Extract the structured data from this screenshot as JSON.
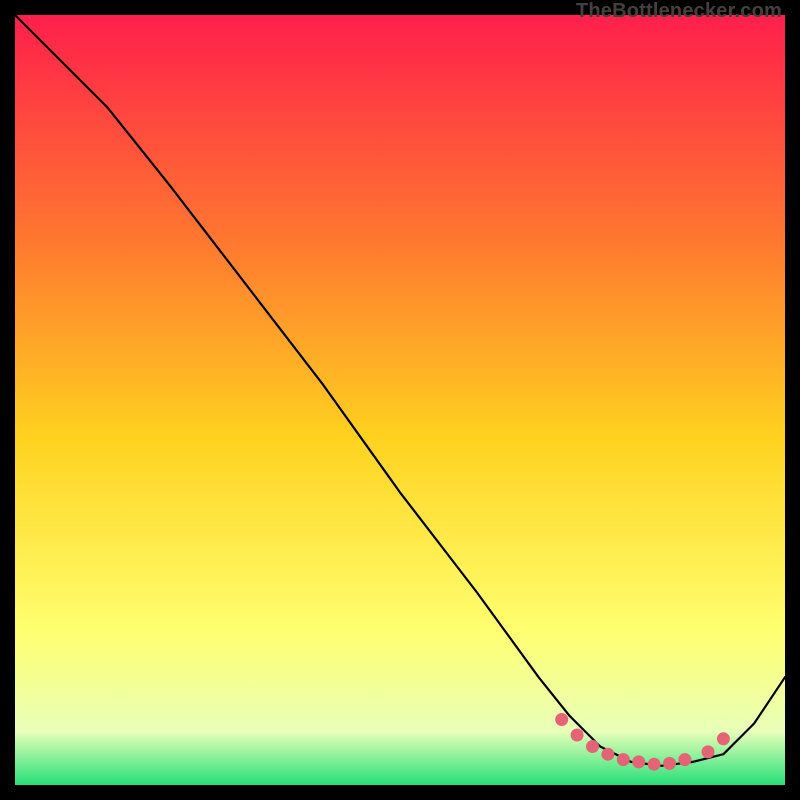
{
  "watermark": "TheBottlenecker.com",
  "colors": {
    "gradient_top": "#ff1f4b",
    "gradient_mid1": "#ff7a2f",
    "gradient_mid2": "#ffd21f",
    "gradient_mid3": "#ffff70",
    "gradient_bottom1": "#e8ffb8",
    "gradient_bottom2": "#26e07a",
    "curve": "#000000",
    "marker": "#e46475",
    "frame": "#000000"
  },
  "chart_data": {
    "type": "line",
    "title": "",
    "xlabel": "",
    "ylabel": "",
    "xlim": [
      0,
      100
    ],
    "ylim": [
      0,
      100
    ],
    "series": [
      {
        "name": "bottleneck-curve",
        "x": [
          0,
          4,
          12,
          20,
          30,
          40,
          50,
          60,
          68,
          72,
          76,
          80,
          84,
          88,
          92,
          96,
          100
        ],
        "y": [
          100,
          96,
          88,
          78,
          65,
          52,
          38,
          25,
          14,
          9,
          5,
          3,
          2.5,
          3,
          4,
          8,
          14
        ]
      }
    ],
    "markers": {
      "name": "highlight-dots",
      "x": [
        71,
        73,
        75,
        77,
        79,
        81,
        83,
        85,
        87,
        90,
        92
      ],
      "y": [
        8.5,
        6.5,
        5.0,
        4.0,
        3.3,
        3.0,
        2.7,
        2.8,
        3.3,
        4.3,
        6.0
      ]
    }
  }
}
